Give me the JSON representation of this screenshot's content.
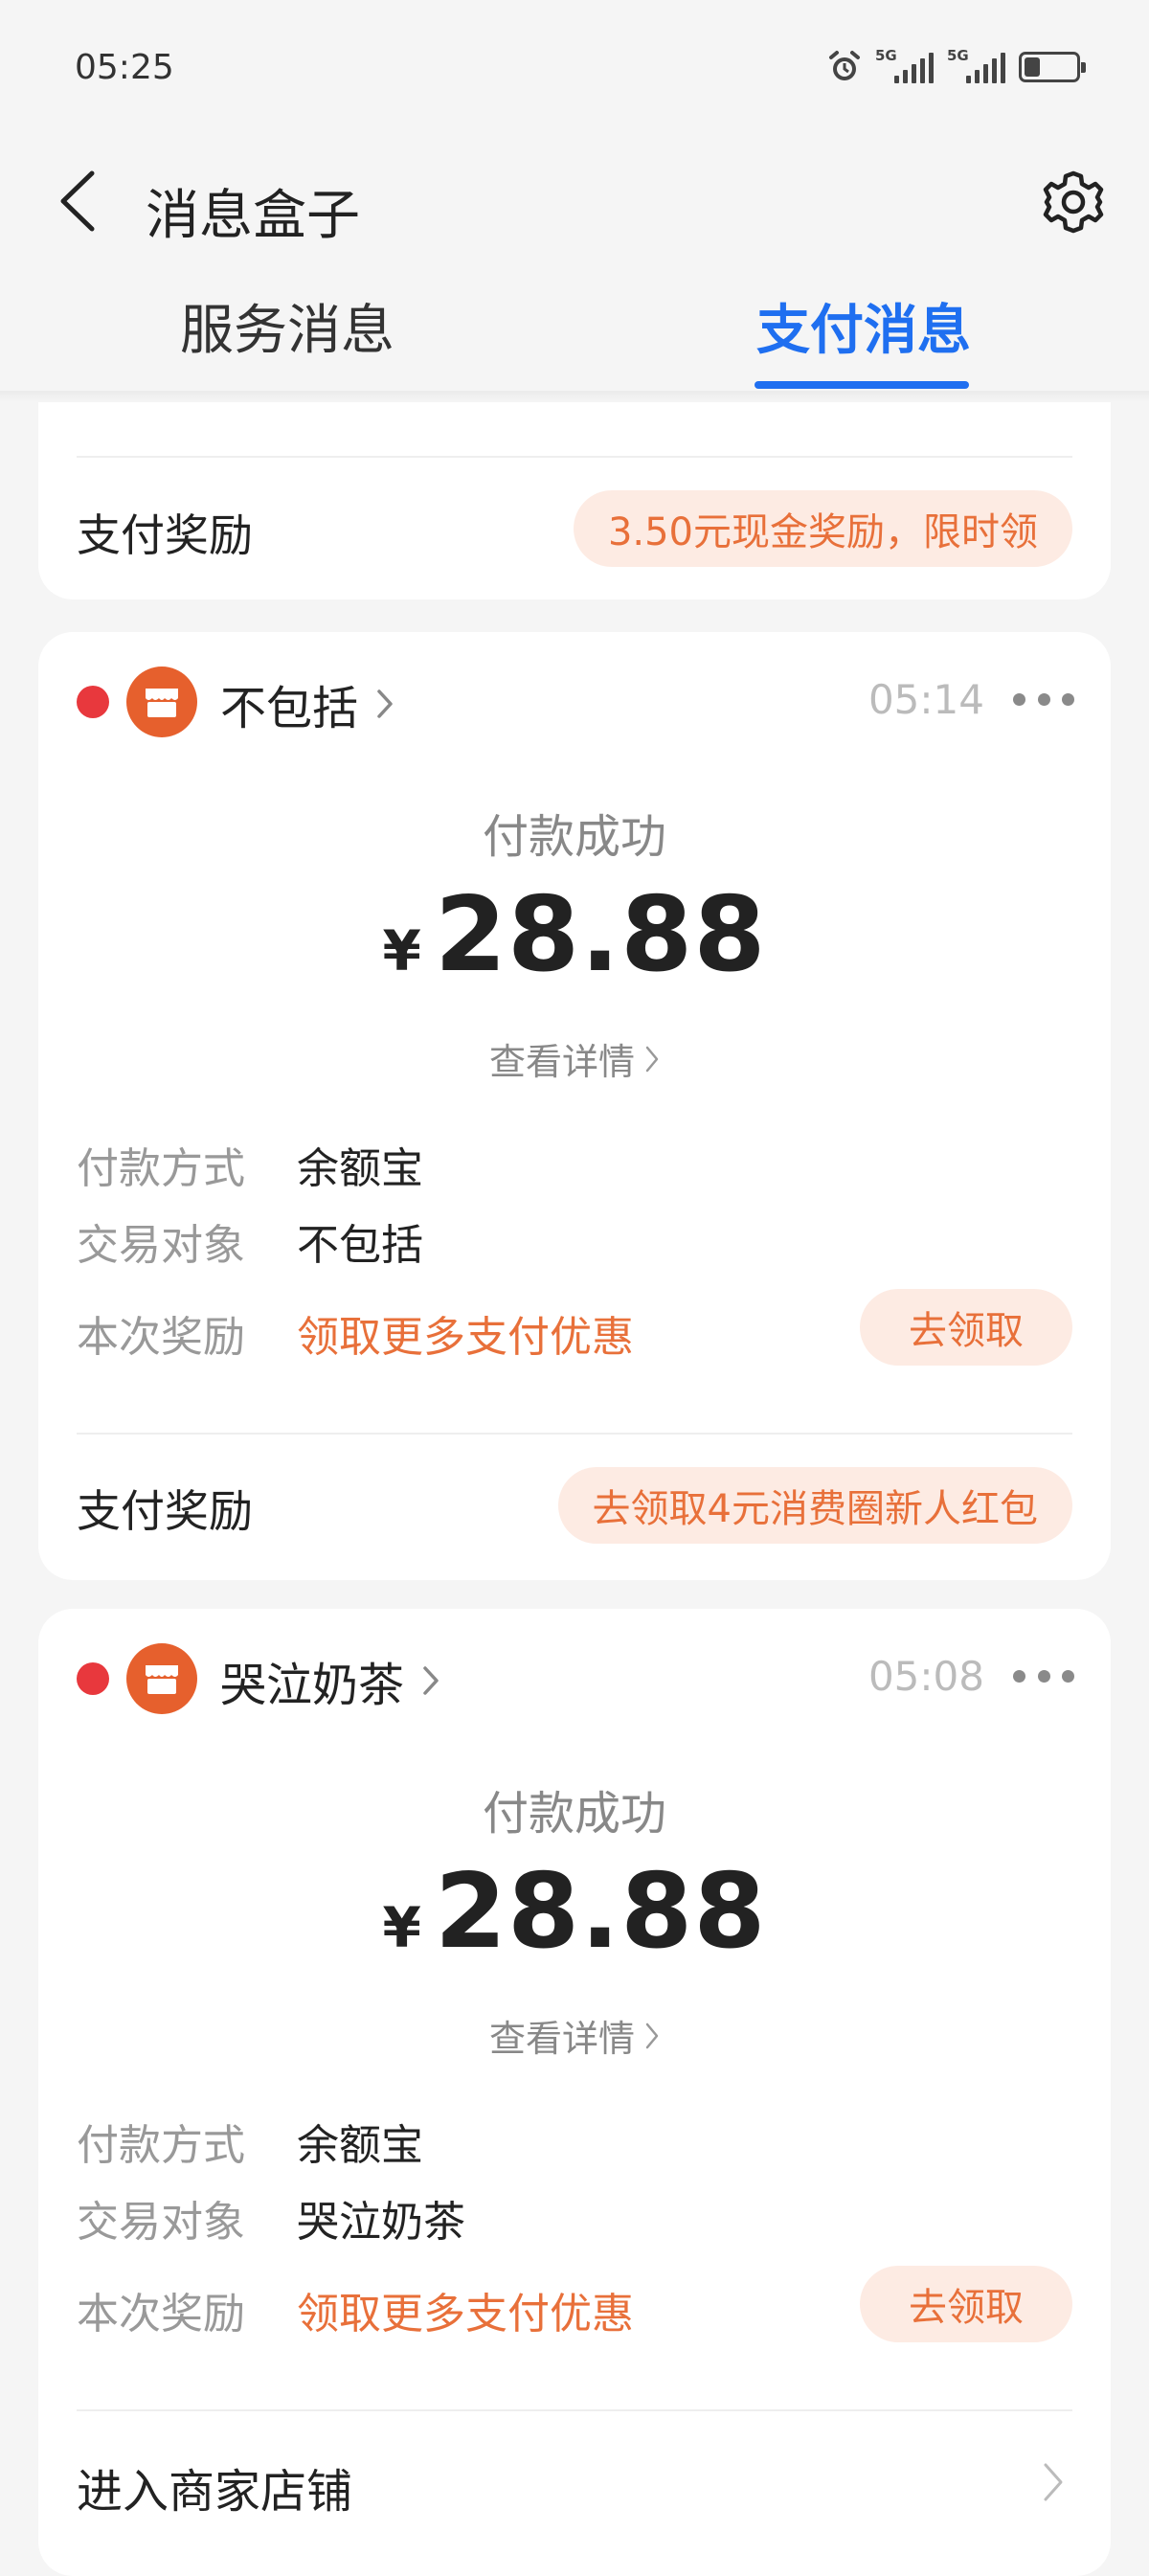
{
  "status_bar": {
    "time": "05:25",
    "signal_tag_1": "5G",
    "signal_tag_2": "5G",
    "battery_level_percent": 30
  },
  "header": {
    "title": "消息盒子",
    "back_icon": "chevron-left-icon",
    "settings_icon": "gear-icon"
  },
  "tabs": {
    "service": "服务消息",
    "payment": "支付消息",
    "active": "payment"
  },
  "partial_card": {
    "reward_label": "支付奖励",
    "reward_pill": "3.50元现金奖励，限时领"
  },
  "messages": [
    {
      "shop_name": "不包括",
      "time": "05:14",
      "status": "付款成功",
      "currency": "¥",
      "amount": "28.88",
      "detail_link": "查看详情",
      "pay_method_label": "付款方式",
      "pay_method_value": "余额宝",
      "counterparty_label": "交易对象",
      "counterparty_value": "不包括",
      "reward_label": "本次奖励",
      "reward_value": "领取更多支付优惠",
      "claim_button": "去领取",
      "footer_label": "支付奖励",
      "footer_pill": "去领取4元消费圈新人红包"
    },
    {
      "shop_name": "哭泣奶茶",
      "time": "05:08",
      "status": "付款成功",
      "currency": "¥",
      "amount": "28.88",
      "detail_link": "查看详情",
      "pay_method_label": "付款方式",
      "pay_method_value": "余额宝",
      "counterparty_label": "交易对象",
      "counterparty_value": "哭泣奶茶",
      "reward_label": "本次奖励",
      "reward_value": "领取更多支付优惠",
      "claim_button": "去领取",
      "footer_label": "进入商家店铺"
    }
  ],
  "colors": {
    "accent_blue": "#1f6ff0",
    "reward_orange": "#e8703a",
    "pill_bg": "#fdebe3",
    "unread_red": "#e8383d",
    "shop_avatar": "#e6602d"
  }
}
